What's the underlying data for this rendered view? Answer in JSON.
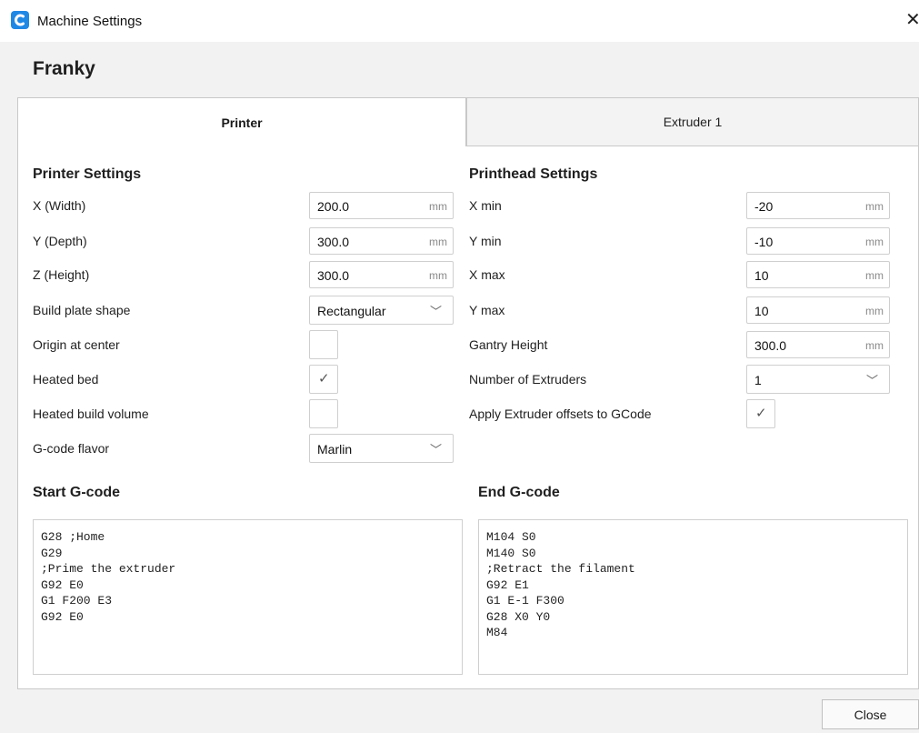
{
  "window": {
    "title": "Machine Settings",
    "close_glyph": "✕"
  },
  "machine_name": "Franky",
  "tabs": {
    "printer": "Printer",
    "extruder": "Extruder 1",
    "active": "Printer"
  },
  "printer_settings": {
    "title": "Printer Settings",
    "x_width": {
      "label": "X (Width)",
      "value": "200.0",
      "unit": "mm"
    },
    "y_depth": {
      "label": "Y (Depth)",
      "value": "300.0",
      "unit": "mm"
    },
    "z_height": {
      "label": "Z (Height)",
      "value": "300.0",
      "unit": "mm"
    },
    "build_plate_shape": {
      "label": "Build plate shape",
      "value": "Rectangular"
    },
    "origin_at_center": {
      "label": "Origin at center",
      "checked": false
    },
    "heated_bed": {
      "label": "Heated bed",
      "checked": true
    },
    "heated_build_volume": {
      "label": "Heated build volume",
      "checked": false
    },
    "gcode_flavor": {
      "label": "G-code flavor",
      "value": "Marlin"
    }
  },
  "printhead_settings": {
    "title": "Printhead Settings",
    "x_min": {
      "label": "X min",
      "value": "-20",
      "unit": "mm"
    },
    "y_min": {
      "label": "Y min",
      "value": "-10",
      "unit": "mm"
    },
    "x_max": {
      "label": "X max",
      "value": "10",
      "unit": "mm"
    },
    "y_max": {
      "label": "Y max",
      "value": "10",
      "unit": "mm"
    },
    "gantry_height": {
      "label": "Gantry Height",
      "value": "300.0",
      "unit": "mm"
    },
    "number_of_extruders": {
      "label": "Number of Extruders",
      "value": "1"
    },
    "apply_extruder_offsets": {
      "label": "Apply Extruder offsets to GCode",
      "checked": true
    }
  },
  "start_gcode": {
    "title": "Start G-code",
    "lines": [
      "G28 ;Home",
      "G29",
      ";Prime the extruder",
      "G92 E0",
      "G1 F200 E3",
      "G92 E0"
    ]
  },
  "end_gcode": {
    "title": "End G-code",
    "lines": [
      "M104 S0",
      "M140 S0",
      ";Retract the filament",
      "G92 E1",
      "G1 E-1 F300",
      "G28 X0 Y0",
      "M84"
    ]
  },
  "footer": {
    "close_label": "Close"
  },
  "icons": {
    "app": "cura-logo-icon",
    "checkmark": "✓",
    "chevron": "﹀"
  },
  "colors": {
    "app_icon": "#1e88e5",
    "dialog_bg": "#f2f2f2",
    "border": "#cfcfcf"
  }
}
